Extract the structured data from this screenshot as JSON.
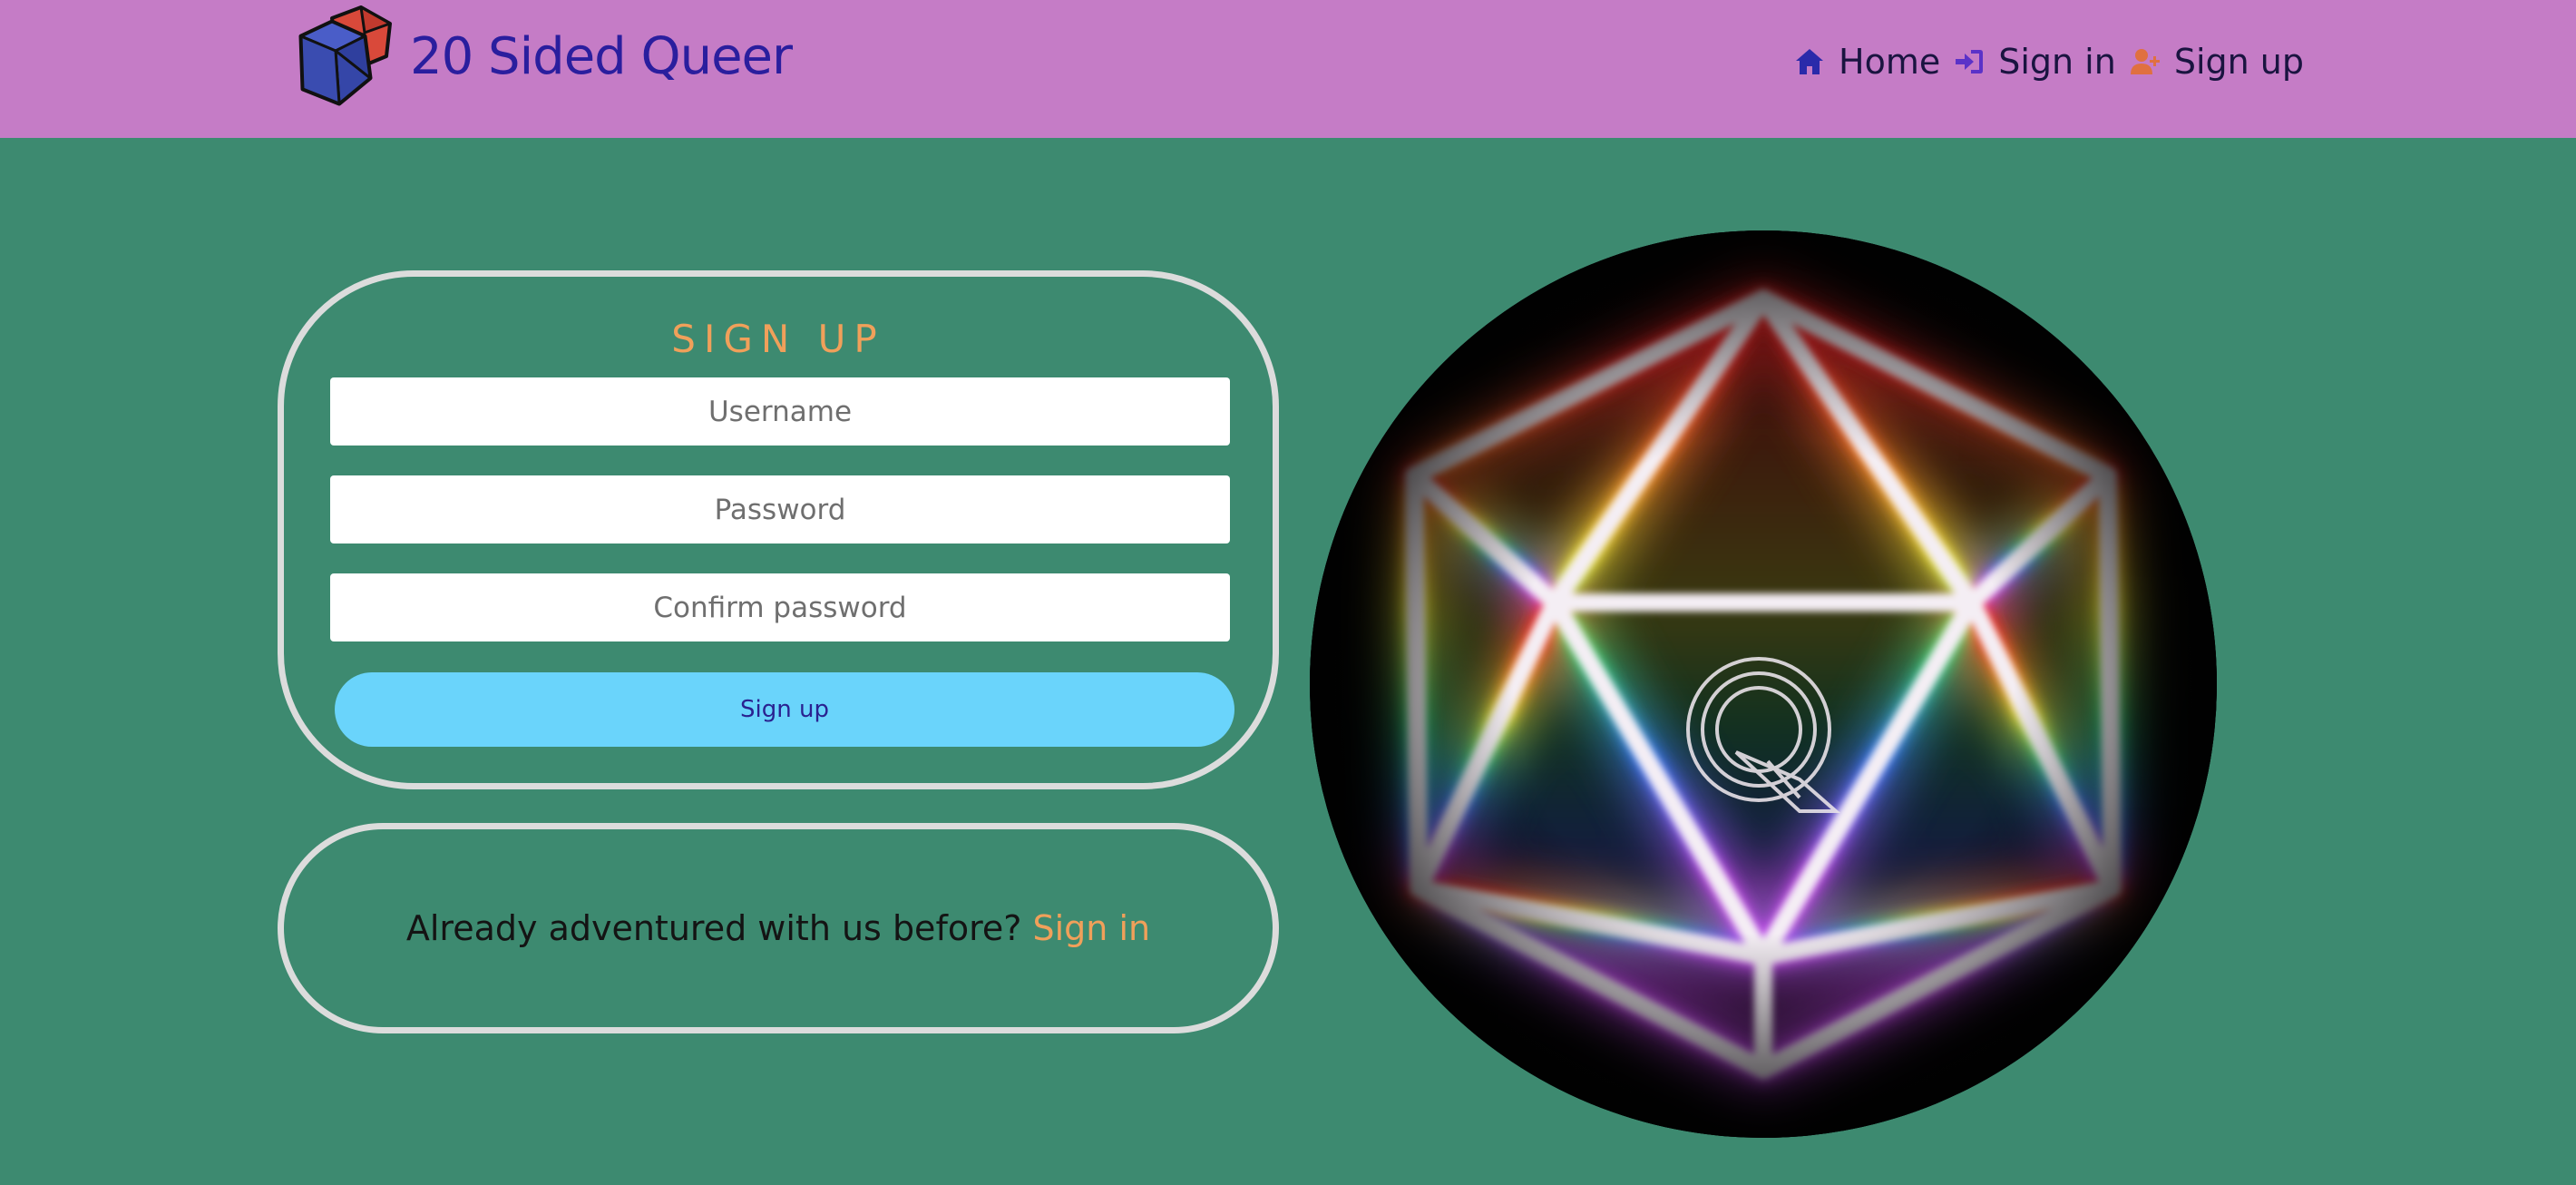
{
  "brand": {
    "name": "20 Sided Queer",
    "logo_icon": "dice-logo-icon",
    "name_color": "#2a1e9e"
  },
  "nav": {
    "items": [
      {
        "label": "Home",
        "icon": "home-icon",
        "icon_color": "#2a2aaa"
      },
      {
        "label": "Sign in",
        "icon": "sign-in-icon",
        "icon_color": "#5a32c8"
      },
      {
        "label": "Sign up",
        "icon": "user-plus-icon",
        "icon_color": "#e07040"
      }
    ]
  },
  "signup_form": {
    "title": "SIGN UP",
    "username_placeholder": "Username",
    "password_placeholder": "Password",
    "confirm_placeholder": "Confirm password",
    "submit_label": "Sign up"
  },
  "signin_prompt": {
    "text": "Already adventured with us before?",
    "link_label": "Sign in"
  },
  "hero": {
    "icon": "d20-neon-icon"
  },
  "colors": {
    "background": "#3d8a70",
    "navbar": "#c57cc6",
    "accent": "#f0a05a",
    "button": "#6ad4fb",
    "card_border": "#dcdcdc"
  }
}
